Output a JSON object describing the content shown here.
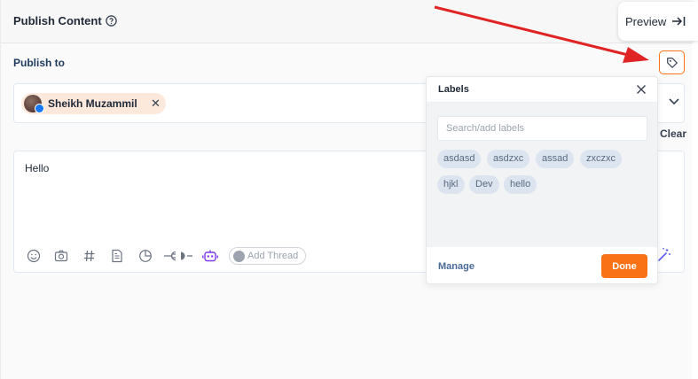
{
  "header": {
    "title": "Publish Content",
    "preview_label": "Preview"
  },
  "publish": {
    "label": "Publish to",
    "account_name": "Sheikh Muzammil",
    "clear_label": "Clear"
  },
  "editor": {
    "content": "Hello",
    "add_thread_label": "Add Thread"
  },
  "labels_popup": {
    "title": "Labels",
    "search_placeholder": "Search/add labels",
    "labels": [
      "asdasd",
      "asdzxc",
      "assad",
      "zxczxc",
      "hjkl",
      "Dev",
      "hello"
    ],
    "manage_label": "Manage",
    "done_label": "Done"
  },
  "colors": {
    "accent": "#f97316",
    "annotation_arrow": "#e02424",
    "label_chip": "#dbe4ef"
  },
  "icons": [
    "help-circle-icon",
    "arrow-to-right-icon",
    "tag-icon",
    "chevron-down-icon",
    "close-icon",
    "emoji-icon",
    "camera-icon",
    "hashtag-icon",
    "document-icon",
    "pie-chart-icon",
    "plug-icon",
    "robot-icon",
    "magic-wand-icon"
  ]
}
